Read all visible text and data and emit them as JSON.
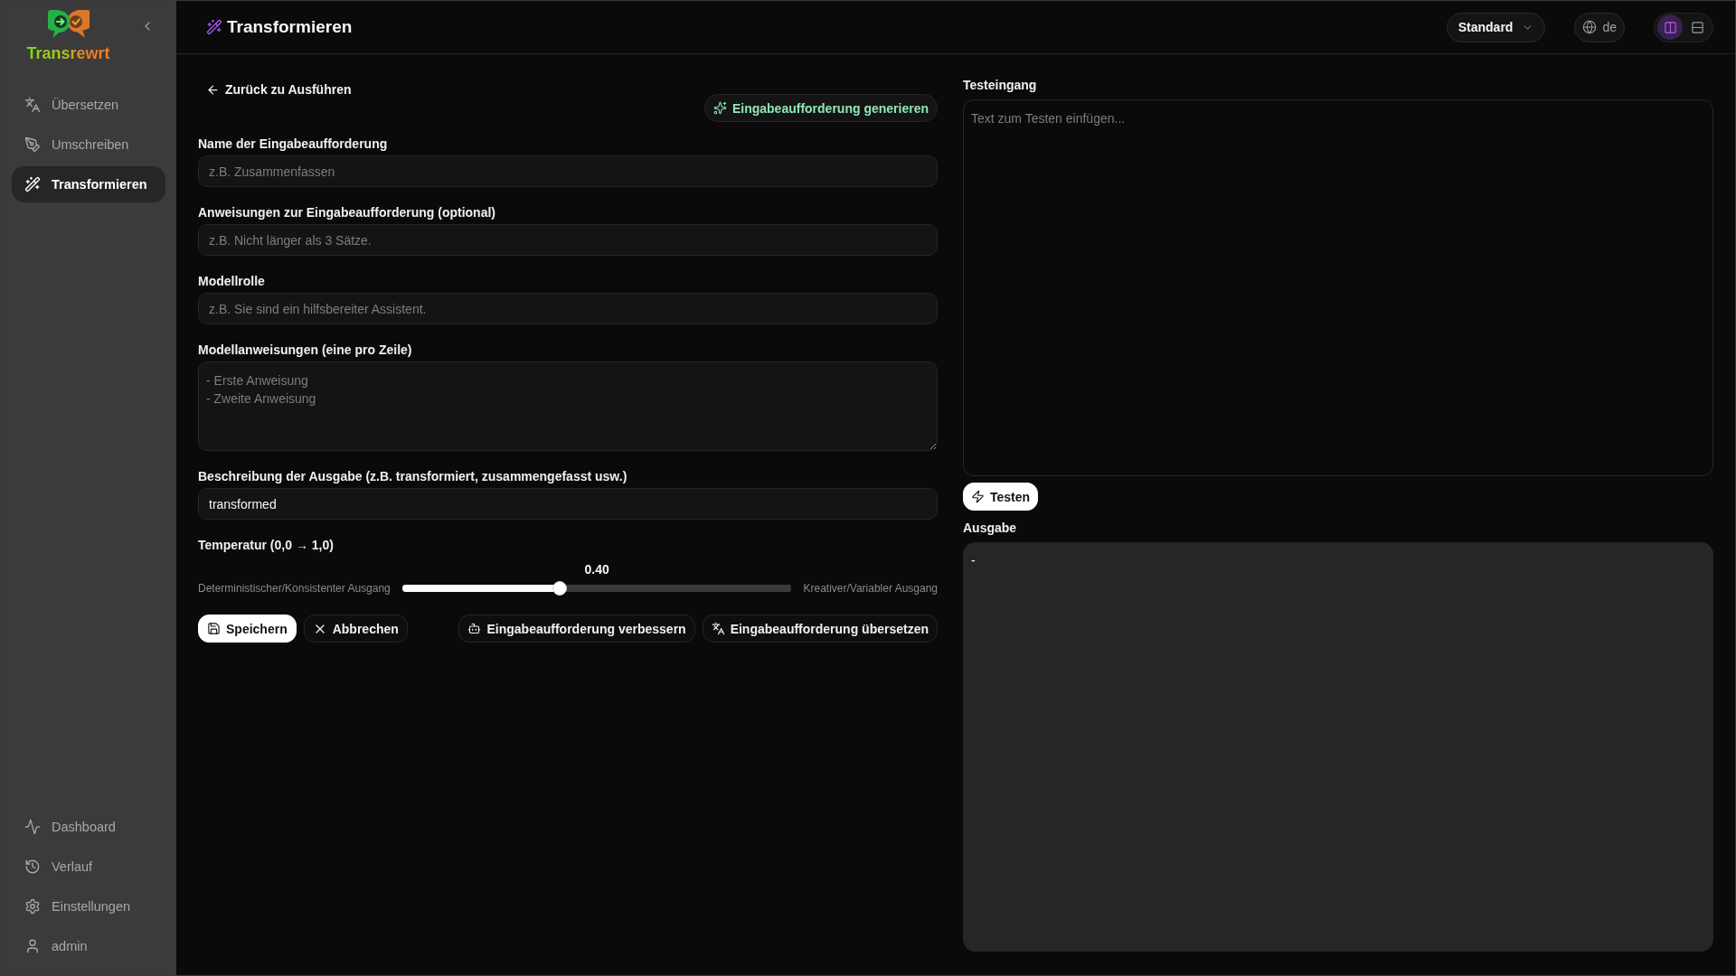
{
  "sidebar": {
    "logo_text": "Transrewrt",
    "nav_items": [
      {
        "label": "Übersetzen",
        "selected": false
      },
      {
        "label": "Umschreiben",
        "selected": false
      },
      {
        "label": "Transformieren",
        "selected": true
      }
    ],
    "footer_items": [
      {
        "label": "Dashboard",
        "selected": false
      },
      {
        "label": "Verlauf",
        "selected": false
      },
      {
        "label": "Einstellungen",
        "selected": false
      },
      {
        "label": "admin",
        "selected": false
      }
    ]
  },
  "header": {
    "title": "Transformieren",
    "model_select": "Standard",
    "language": "de",
    "layout_options": [
      {
        "selected": true
      },
      {
        "selected": false
      }
    ]
  },
  "form": {
    "back_link": "Zurück zu Ausführen",
    "generate_button": "Eingabeaufforderung generieren",
    "fields": [
      {
        "kind": "input",
        "label": "Name der Eingabeaufforderung",
        "placeholder": "z.B. Zusammenfassen"
      },
      {
        "kind": "input",
        "label": "Anweisungen zur Eingabeaufforderung (optional)",
        "placeholder": "z.B. Nicht länger als 3 Sätze."
      },
      {
        "kind": "input",
        "label": "Modellrolle",
        "placeholder": "z.B. Sie sind ein hilfsbereiter Assistent."
      },
      {
        "kind": "textarea",
        "label": "Modellanweisungen (eine pro Zeile)",
        "placeholder": "- Erste Anweisung\n- Zweite Anweisung"
      },
      {
        "kind": "input",
        "label": "Beschreibung der Ausgabe (z.B. transformiert, zusammengefasst usw.)",
        "value": "transformed"
      }
    ],
    "temperature": {
      "label": "Temperatur (0,0 → 1,0)",
      "reading": "0.40",
      "level": 0.4,
      "min_label": "Deterministischer/Konsistenter Ausgang",
      "max_label": "Kreativer/Variabler Ausgang"
    },
    "buttons": [
      {
        "kind": "primary",
        "label": "Speichern"
      },
      {
        "kind": "secondary",
        "label": "Abbrechen"
      }
    ],
    "tool_buttons": [
      "Eingabeaufforderung verbessern",
      "Eingabeaufforderung übersetzen"
    ]
  },
  "test": {
    "input_label": "Testeingang",
    "placeholder": "Text zum Testen einfügen...",
    "run_button": "Testen",
    "output_label": "Ausgabe",
    "output": "-"
  }
}
